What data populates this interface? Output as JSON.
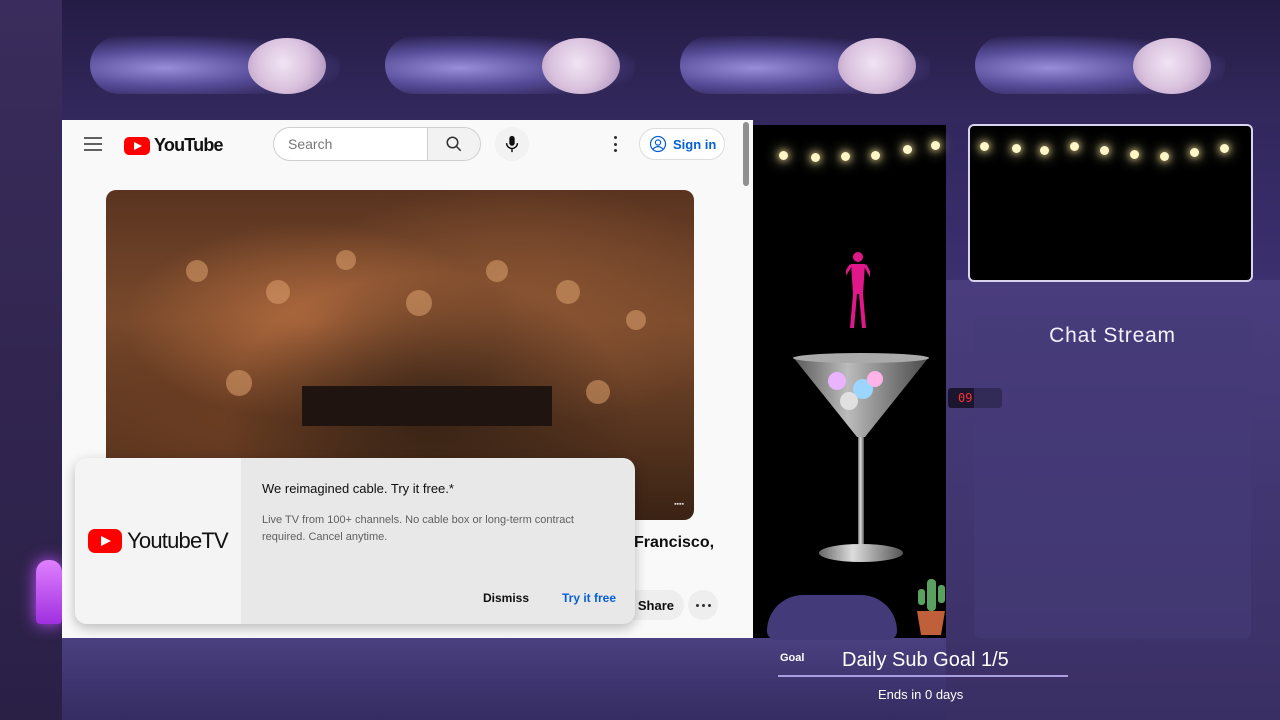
{
  "youtube": {
    "logo_text": "YouTube",
    "search_placeholder": "Search",
    "signin_label": "Sign in",
    "video_title_snippet": "Francisco,",
    "share_label": "Share"
  },
  "promo": {
    "logo_text": "YoutubeTV",
    "title": "We reimagined cable. Try it free.*",
    "description": "Live TV from 100+ channels. No cable box or long-term contract required. Cancel anytime.",
    "dismiss_label": "Dismiss",
    "try_label": "Try it free"
  },
  "overlay": {
    "chat_title": "Chat Stream",
    "goal_label": "Goal",
    "goal_text": "Daily Sub Goal 1/5",
    "goal_ends": "Ends in 0 days"
  },
  "colors": {
    "youtube_red": "#ff0000",
    "link_blue": "#065fd4",
    "dancer_pink": "#e0188a",
    "overlay_purple": "#3c3070"
  },
  "icons": [
    "menu-icon",
    "search-icon",
    "mic-icon",
    "more-vert-icon",
    "account-icon",
    "more-horiz-icon"
  ]
}
